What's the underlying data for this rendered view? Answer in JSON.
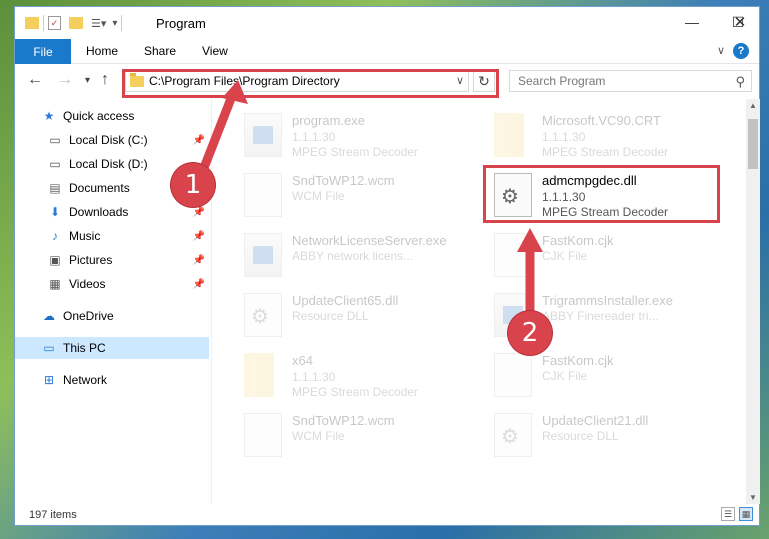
{
  "window": {
    "title": "Program",
    "controls": {
      "minimize": "—",
      "maximize": "☐",
      "close": "✕"
    }
  },
  "ribbon": {
    "tabs": [
      "File",
      "Home",
      "Share",
      "View"
    ],
    "help": "?"
  },
  "navigation": {
    "address": "C:\\Program Files\\Program Directory",
    "search_placeholder": "Search Program"
  },
  "sidebar": {
    "items": [
      {
        "label": "Quick access",
        "icon": "star-icon",
        "pinned": false
      },
      {
        "label": "Local Disk (C:)",
        "icon": "drive-icon",
        "pinned": true
      },
      {
        "label": "Local Disk (D:)",
        "icon": "drive-icon",
        "pinned": false
      },
      {
        "label": "Documents",
        "icon": "documents-icon",
        "pinned": true
      },
      {
        "label": "Downloads",
        "icon": "download-icon",
        "pinned": true
      },
      {
        "label": "Music",
        "icon": "music-icon",
        "pinned": true
      },
      {
        "label": "Pictures",
        "icon": "pictures-icon",
        "pinned": true
      },
      {
        "label": "Videos",
        "icon": "videos-icon",
        "pinned": true
      },
      {
        "label": "OneDrive",
        "icon": "cloud-icon",
        "pinned": false
      },
      {
        "label": "This PC",
        "icon": "computer-icon",
        "pinned": false,
        "selected": true
      },
      {
        "label": "Network",
        "icon": "network-icon",
        "pinned": false
      }
    ]
  },
  "files": [
    {
      "name": "program.exe",
      "version": "1.1.1.30",
      "description": "MPEG Stream Decoder",
      "type": "exe"
    },
    {
      "name": "Microsoft.VC90.CRT",
      "version": "1.1.1.30",
      "description": "MPEG Stream Decoder",
      "type": "folder"
    },
    {
      "name": "SndToWP12.wcm",
      "version": "",
      "description": "WCM File",
      "type": "file"
    },
    {
      "name": "admcmpgdec.dll",
      "version": "1.1.1.30",
      "description": "MPEG Stream Decoder",
      "type": "dll",
      "highlighted": true
    },
    {
      "name": "NetworkLicenseServer.exe",
      "version": "",
      "description": "ABBY network licens...",
      "type": "exe"
    },
    {
      "name": "FastKom.cjk",
      "version": "",
      "description": "CJK File",
      "type": "file"
    },
    {
      "name": "UpdateClient65.dll",
      "version": "",
      "description": "Resource DLL",
      "type": "dll"
    },
    {
      "name": "TrigrammsInstaller.exe",
      "version": "",
      "description": "ABBY Finereader tri...",
      "type": "exe"
    },
    {
      "name": "x64",
      "version": "1.1.1.30",
      "description": "MPEG Stream Decoder",
      "type": "folder"
    },
    {
      "name": "FastKom.cjk",
      "version": "",
      "description": "CJK File",
      "type": "file"
    },
    {
      "name": "SndToWP12.wcm",
      "version": "",
      "description": "WCM File",
      "type": "file"
    },
    {
      "name": "UpdateClient21.dll",
      "version": "",
      "description": "Resource DLL",
      "type": "dll"
    }
  ],
  "status": {
    "item_count": "197 items"
  },
  "annotations": {
    "step1": "1",
    "step2": "2",
    "color": "#d9434c"
  }
}
